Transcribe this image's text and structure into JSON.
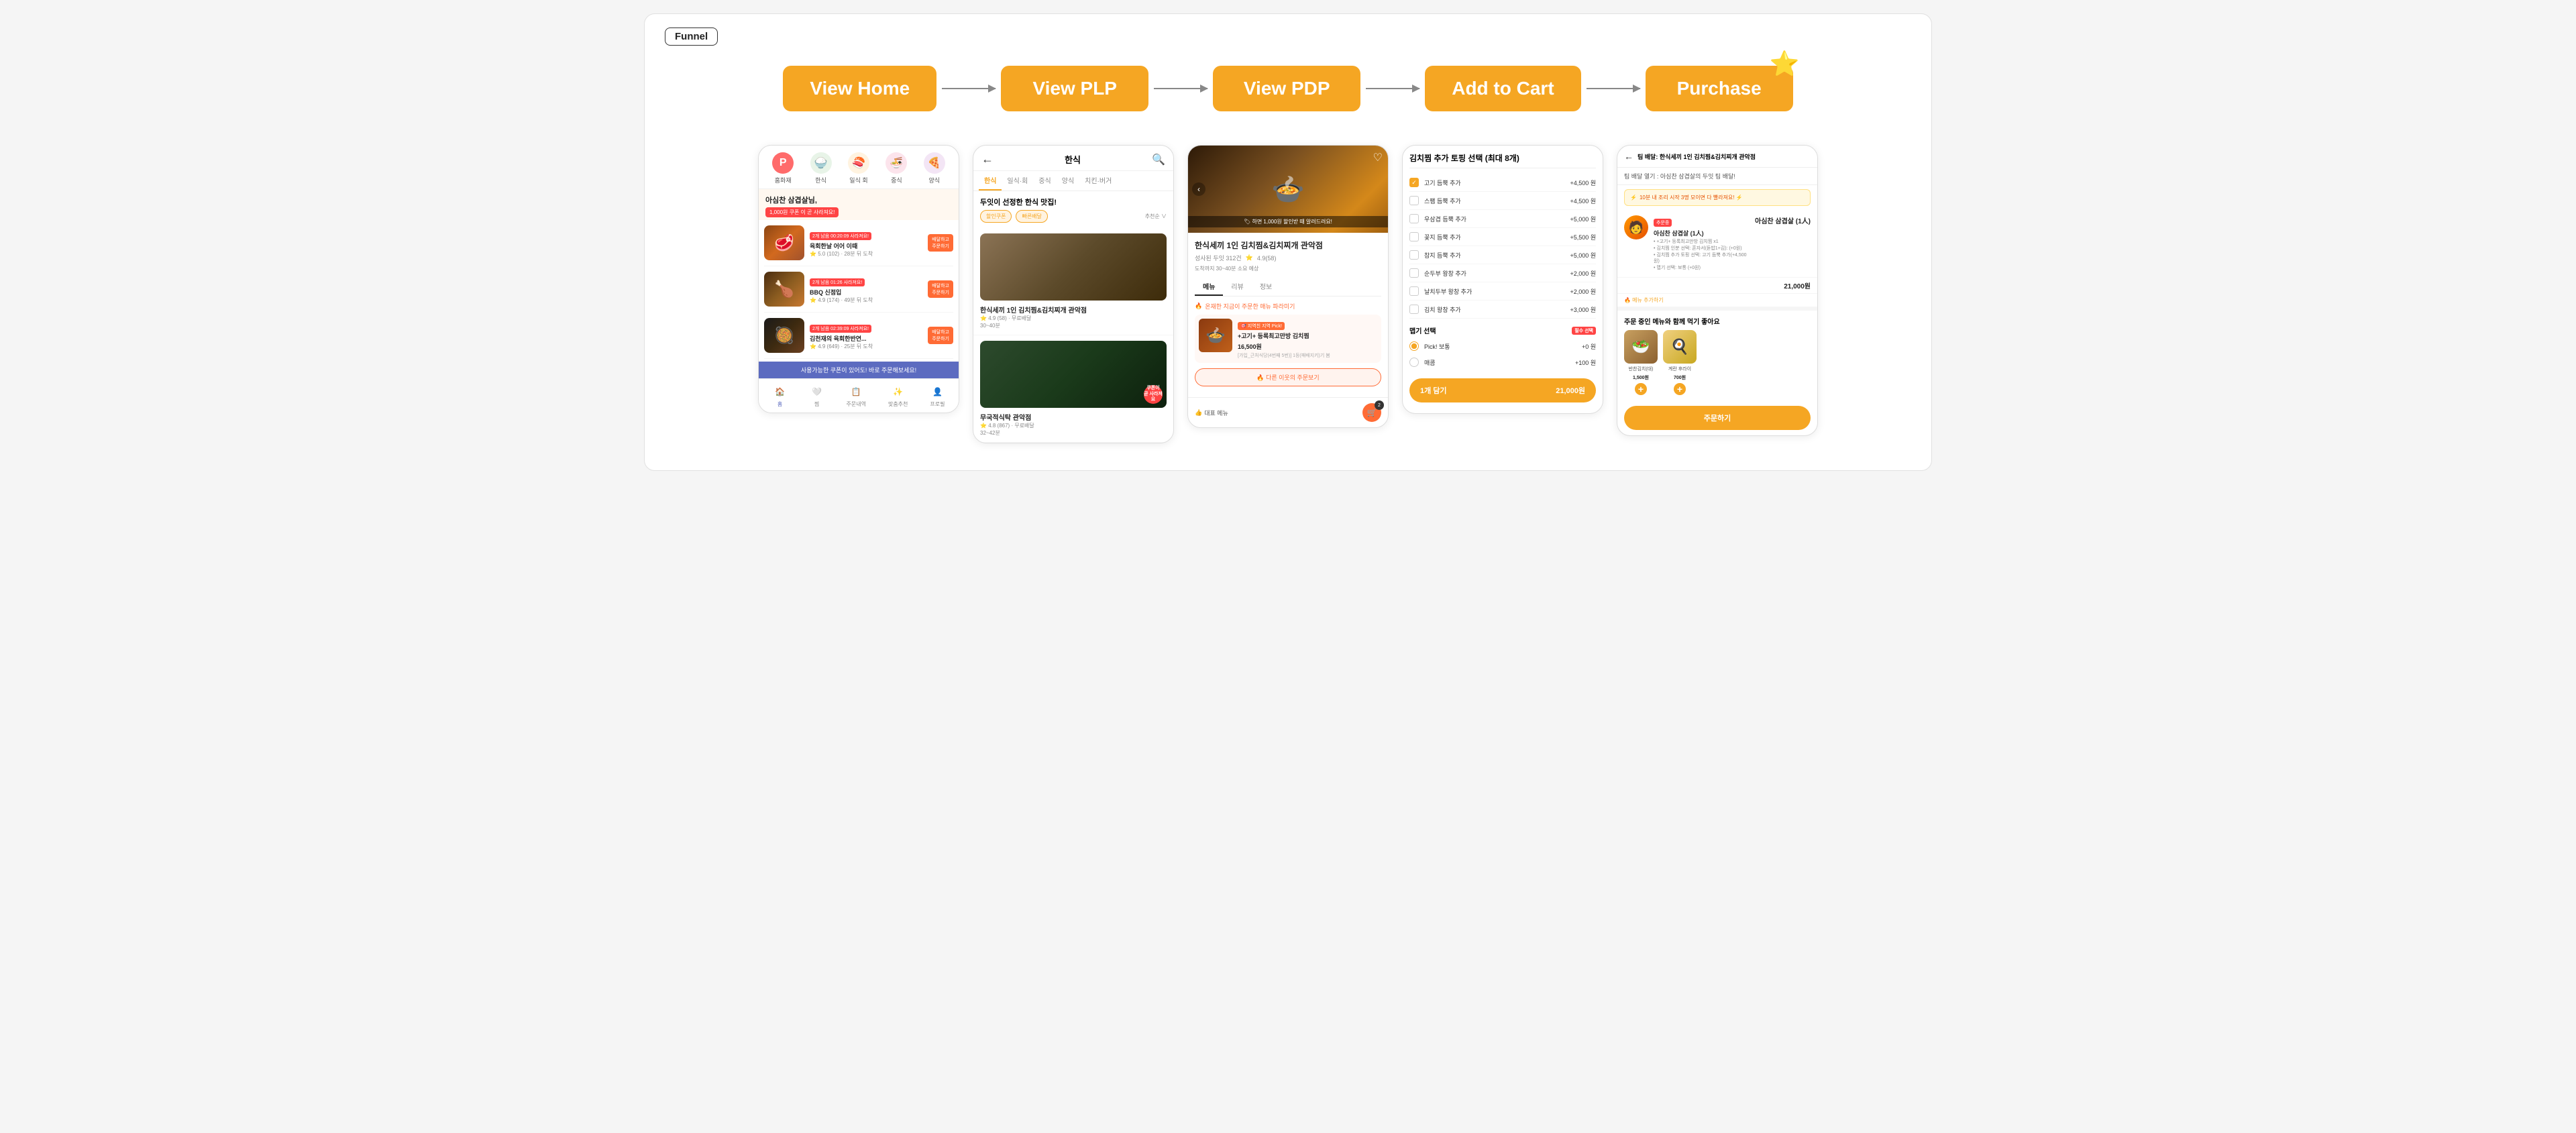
{
  "app": {
    "title": "Funnel"
  },
  "steps": [
    {
      "id": "view-home",
      "label": "View Home",
      "has_star": false
    },
    {
      "id": "view-plp",
      "label": "View PLP",
      "has_star": false
    },
    {
      "id": "view-pdp",
      "label": "View PDP",
      "has_star": false
    },
    {
      "id": "add-to-cart",
      "label": "Add to Cart",
      "has_star": false
    },
    {
      "id": "purchase",
      "label": "Purchase",
      "has_star": true
    }
  ],
  "screen1": {
    "categories": [
      "홈화재",
      "한식",
      "일식 회",
      "중식",
      "양식"
    ],
    "greeting": "아심찬 삼겹살님,",
    "coupon": "1,000원 쿠폰 이 곧 사라져요!",
    "items": [
      {
        "name": "육회한날 어어 이때",
        "badge": "2개 남음 00:20:09 사라져요!",
        "rating": "5.0 (102)",
        "delivery": "28분 뒤 도착"
      },
      {
        "name": "BBQ 신점입",
        "badge": "2개 남음 01:26 사라져요!",
        "rating": "4.9 (174)",
        "delivery": "49분 뒤 도착"
      },
      {
        "name": "김천재의 육회한반연...",
        "badge": "2개 남음 02:39:09 사라져요!",
        "rating": "4.9 (649)",
        "delivery": "25분 뒤 도착"
      }
    ],
    "banner": "사용가능한 쿠폰이 있어도! 바로 주문해보세요!",
    "nav": [
      "홈",
      "찜",
      "주문내역",
      "맞춤추천",
      "프로필"
    ]
  },
  "screen2": {
    "back": "←",
    "title": "한식",
    "search_icon": "🔍",
    "tabs": [
      "한식",
      "일식·회",
      "중식",
      "양식",
      "치킨·버거"
    ],
    "subtitle": "두잇이 선정한 한식 맛집!",
    "filter_tag": "할인쿠폰",
    "filter_tag2": "빠른배달",
    "sort": "추천순 ∨",
    "restaurants": [
      {
        "name": "한식세끼 1인 김치찜&김치찌개 관악점",
        "rating": "4.9 (58)",
        "delivery": "무료배달",
        "time": "30~40분"
      },
      {
        "name": "무국적식탁 관악점",
        "rating": "4.8 (867)",
        "delivery": "무료배달",
        "time": "32~42분"
      }
    ]
  },
  "screen3": {
    "rest_name": "한식세끼 1인 김치찜&김치찌개 관악점",
    "sales_count": "성사된 두잇 312건",
    "rating": "4.9(58)",
    "delivery_time": "도착까지 30~40분 소요 예상",
    "tabs": [
      "메뉴",
      "리뷰",
      "정보"
    ],
    "hot_label": "온재한 지금이 주문한 매뉴 파라미기",
    "menu_badge_label": "지역친 지역 Pick!",
    "menu_name": "+고기+ 등록최고만방 김치찜",
    "menu_price": "16,500원",
    "menu_desc": "[가입_근처식당(4번째 5번)] 1등(패배지키)기 봄",
    "neighbor_btn": "🔥 다른 이웃의 주문보기",
    "representative_menu": "대표 메뉴",
    "cart_count": "2",
    "discount_notice": "🏷 하면 1,000원 할인받 때 알려드려요!",
    "heart": "♡"
  },
  "screen4": {
    "title": "김치찜 추가 토핑 선택 (최대 8개)",
    "options": [
      {
        "label": "고기 듬뿍 추가",
        "price": "+4,500 원",
        "checked": true
      },
      {
        "label": "스팸 듬뿍 추가",
        "price": "+4,500 원",
        "checked": false
      },
      {
        "label": "우삼겹 듬뿍 추가",
        "price": "+5,000 원",
        "checked": false
      },
      {
        "label": "꽃지 듬뿍 추가",
        "price": "+5,500 원",
        "checked": false
      },
      {
        "label": "참지 듬뿍 추가",
        "price": "+5,000 원",
        "checked": false
      },
      {
        "label": "순두부 왕창 추가",
        "price": "+2,000 원",
        "checked": false
      },
      {
        "label": "날치두부 왕창 추가",
        "price": "+2,000 원",
        "checked": false
      },
      {
        "label": "김치 왕창 추가",
        "price": "+3,000 원",
        "checked": false
      }
    ],
    "spicy_section": "맵기 선택",
    "required": "필수 선택",
    "spicy_options": [
      {
        "label": "Pick! 보통",
        "price": "+0 원",
        "checked": true
      },
      {
        "label": "매콤",
        "price": "+100 원",
        "checked": false
      }
    ],
    "add_btn_qty": "1개 담기",
    "add_btn_price": "21,000원"
  },
  "screen5": {
    "back": "←",
    "header_title": "팀 배달: 한식세끼 1인 김치찜&김치찌개 관악점",
    "delivery_header": "팀 배달 열기 : 아심찬 삼겹살의 두잇 팀 배달!",
    "promo": "10분 내 조리 시작 3명 모이면 다 빨라져요! ⚡",
    "order_name": "아심찬 삼겹살 (1人)",
    "order_tag": "추문중",
    "order_price": "21,000원",
    "order_details": [
      "+고기+ 등록최고만방 김치찜 x1",
      "김치찜 인분 선택: 혼자서(듣밥1+김): (+0원)",
      "김치찜 추가 토핑 선택: 고기 듬뿍 추가(+4,500원)",
      "맵기 선택: 보통 (+0원)"
    ],
    "add_menu_btn": "🔥 메뉴 추가하기",
    "popular_title": "주문 중인 메뉴와 함께 먹기 좋아요",
    "popular_items": [
      {
        "name": "반찬김치(대)",
        "price": "1,500원"
      },
      {
        "name": "계란 후라이",
        "price": "700원"
      }
    ],
    "order_btn": "주문하기"
  }
}
